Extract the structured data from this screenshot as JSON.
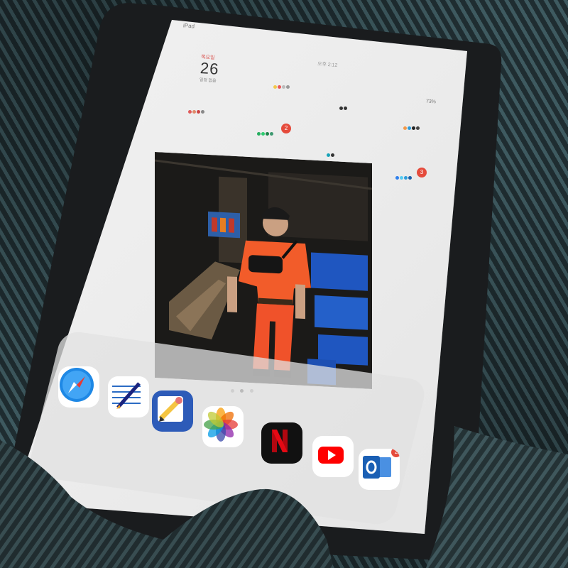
{
  "status_bar": {
    "carrier": "iPad",
    "time": "오후 2:12",
    "battery": "73%"
  },
  "date_widget": {
    "weekday": "목요일",
    "day": "26",
    "event": "일정 없음"
  },
  "widgets": [
    {
      "name": "widget-group-1",
      "badge": ""
    },
    {
      "name": "widget-group-2",
      "badge": ""
    },
    {
      "name": "widget-group-3",
      "badge": "2"
    },
    {
      "name": "widget-group-4",
      "badge": ""
    },
    {
      "name": "widget-group-5",
      "badge": "3"
    }
  ],
  "wallpaper_photo": {
    "subject": "person in orange outfit in a room with blue crates"
  },
  "page_indicator": {
    "pages": 3,
    "current": 2
  },
  "dock": {
    "apps": [
      {
        "name": "Safari",
        "icon": "safari-icon"
      },
      {
        "name": "Notes",
        "icon": "notes-pen-icon"
      },
      {
        "name": "Sketch",
        "icon": "pencil-sketch-icon"
      },
      {
        "name": "Photos",
        "icon": "photos-icon"
      },
      {
        "name": "Netflix",
        "icon": "netflix-icon"
      },
      {
        "name": "YouTube",
        "icon": "youtube-icon"
      },
      {
        "name": "Outlook",
        "icon": "outlook-icon",
        "badge": "2"
      }
    ]
  },
  "colors": {
    "screen": "#ebebeb",
    "bezel": "#1a1c1e",
    "accent_orange": "#f25c2a",
    "netflix_red": "#e50914",
    "youtube_red": "#ff0000",
    "outlook_blue": "#1a5fb4",
    "badge_red": "#e54b3c"
  }
}
